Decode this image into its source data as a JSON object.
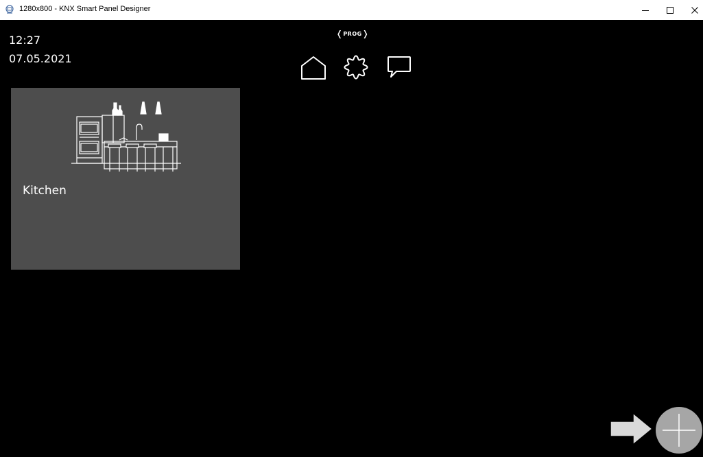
{
  "window": {
    "title": "1280x800 - KNX Smart Panel Designer"
  },
  "panel": {
    "time": "12:27",
    "date": "07.05.2021",
    "prog_label": "PROG",
    "nav": [
      {
        "icon": "home-icon"
      },
      {
        "icon": "gear-icon"
      },
      {
        "icon": "chat-icon"
      }
    ],
    "rooms": [
      {
        "label": "Kitchen",
        "icon": "kitchen-illustration"
      }
    ]
  },
  "colors": {
    "background": "#000000",
    "tile": "#4d4d4d",
    "add_button": "#a6a6a6",
    "arrow_fill": "#d9d9d9"
  }
}
